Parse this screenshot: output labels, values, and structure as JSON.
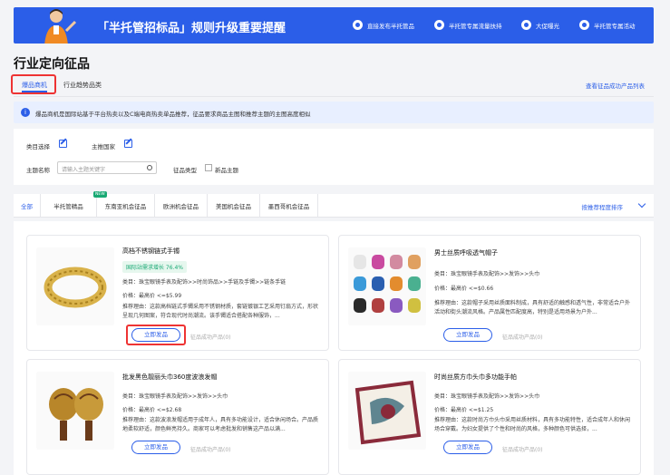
{
  "banner": {
    "title": "「半托管招标品」规则升级重要提醒",
    "nav": [
      "直接发布半托管品",
      "半托管专属流量扶持",
      "大促曝光",
      "半托管专属活动"
    ]
  },
  "page_title": "行业定向征品",
  "tabs": [
    "爆品商机",
    "行业趋势品类"
  ],
  "top_link": "查看征品成功产品列表",
  "info_text": "爆品商机是国际站基于平台热卖以及C端电商热卖单品推荐，征品要求商品主图和推荐主题的主图高度相似",
  "filters": {
    "category_label": "类目选择",
    "country_label": "主推国家",
    "topic_label": "主题名称",
    "topic_placeholder": "请输入主题关键字",
    "type_label": "征品类型",
    "new_topic_label": "新品主题"
  },
  "category_tabs": [
    "全部",
    "半托管精品",
    "东南亚机会征品",
    "欧洲机会征品",
    "美国机会征品",
    "墨西哥机会征品"
  ],
  "new_badge": "NEW",
  "sort_label": "按推荐程度排序",
  "cards": [
    {
      "title": "高档不锈钢链式手镯",
      "badge": "国际站需求增长 76.4%",
      "category": "类目：珠宝眼镜手表及配饰>>时尚饰品>>手链及手镯>>链条手链",
      "price": "价格：最高价 <=$5.99",
      "reason": "推荐理由：这款高档链式手镯采用不锈钢材质，套链镀银工艺采用钉扇方式，形状呈现几何图案，符合现代时尚潮流。该手镯适合搭配各种服饰，...",
      "button": "立即发品",
      "sub": "征品成功产品(0)",
      "colors": [
        "#d9b24a",
        "#a8801f"
      ]
    },
    {
      "title": "男士丝质呼吸透气帽子",
      "category": "类目：珠宝眼镜手表及配饰>>发饰>>头巾",
      "price": "价格：最高价 <=$0.66",
      "reason": "推荐理由：这款帽子采用丝质面料制成，具有舒适的触感和透气性，非常适合户外活动和街头潮流风格。产品属性匹配度高，特别是适用场景为户外...",
      "button": "立即发品",
      "sub": "征品成功产品(0)",
      "colors": [
        "#c94aa0",
        "#3b9ad9",
        "#e38c2e",
        "#2a2a2a"
      ]
    },
    {
      "title": "批发黑色靓丽头巾360度波浪发帽",
      "category": "类目：珠宝眼镜手表及配饰>>发饰>>头巾",
      "price": "价格：最高价 <=$2.68",
      "reason": "推荐理由：这款波浪发帽适用于成年人，具有多功能设计，适合休闲场合。产品质地柔软舒适，颜色鲜亮持久。商家可以考虑批发和销售这产品以满...",
      "button": "立即发品",
      "sub": "征品成功产品(0)",
      "colors": [
        "#b8862a",
        "#6a3b1a"
      ]
    },
    {
      "title": "时尚丝质方巾头巾多功能手帕",
      "category": "类目：珠宝眼镜手表及配饰>>发饰>>头巾",
      "price": "价格：最高价 <=$1.25",
      "reason": "推荐理由：这款时尚方巾头巾采用丝质材料，具有多功能特性，适合成年人和休闲场合穿戴。为妇女提供了个性和时尚的风格，多种颜色可供选择，...",
      "button": "立即发品",
      "sub": "征品成功产品(0)",
      "colors": [
        "#8a2a3a",
        "#3a6a7a"
      ]
    }
  ]
}
